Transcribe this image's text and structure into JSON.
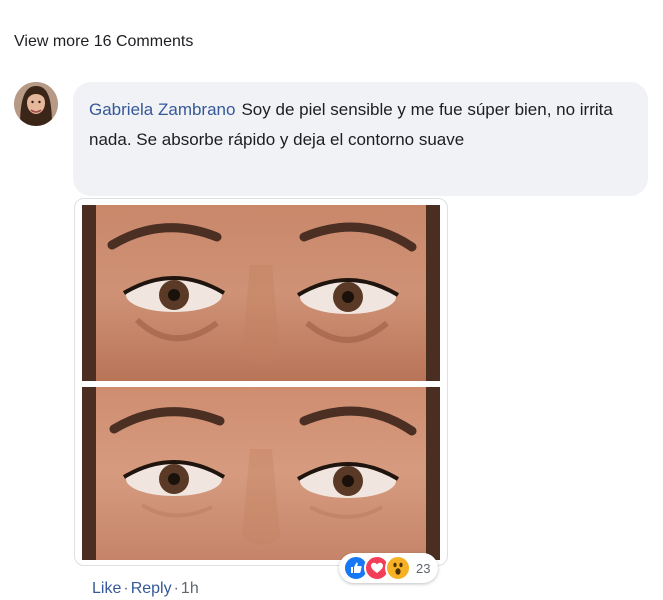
{
  "thread": {
    "view_more_label": "View more 16 Comments"
  },
  "comment": {
    "author": "Gabriela Zambrano",
    "text": "Soy de piel sensible y me fue súper bien, no irrita nada. Se absorbe rápido y deja el contorno suave",
    "attachment": {
      "photos": [
        {
          "kind": "before",
          "icon": "eyes-photo"
        },
        {
          "kind": "after",
          "icon": "eyes-photo"
        }
      ]
    },
    "reactions": {
      "types": [
        "like-icon",
        "love-icon",
        "wow-icon"
      ],
      "count": "23",
      "colors": {
        "like": "#1877f2",
        "love": "#f33e58",
        "wow": "#f7b125"
      }
    },
    "actions": {
      "like_label": "Like",
      "reply_label": "Reply",
      "separator": "·",
      "timestamp": "1h"
    }
  },
  "colors": {
    "link": "#365899",
    "bubble": "#f0f2f5",
    "muted": "#606770"
  }
}
